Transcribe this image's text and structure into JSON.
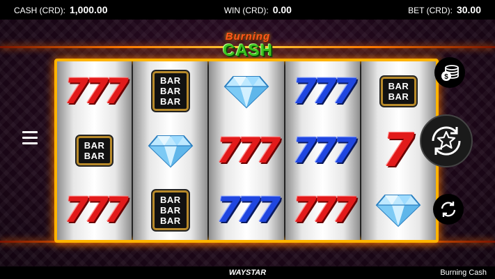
{
  "topbar": {
    "cash_label": "CASH (CRD):",
    "cash_value": "1,000.00",
    "win_label": "WIN (CRD):",
    "win_value": "0.00",
    "bet_label": "BET (CRD):",
    "bet_value": "30.00"
  },
  "logo": {
    "line1": "Burning",
    "line2": "CASH"
  },
  "reels": [
    [
      {
        "type": "seven",
        "variant": "triple-red"
      },
      {
        "type": "bar",
        "lines": [
          "BAR",
          "BAR"
        ]
      },
      {
        "type": "seven",
        "variant": "triple-red"
      }
    ],
    [
      {
        "type": "bar",
        "lines": [
          "BAR",
          "BAR",
          "BAR"
        ]
      },
      {
        "type": "diamond"
      },
      {
        "type": "bar",
        "lines": [
          "BAR",
          "BAR",
          "BAR"
        ]
      }
    ],
    [
      {
        "type": "diamond"
      },
      {
        "type": "seven",
        "variant": "triple-red"
      },
      {
        "type": "seven",
        "variant": "triple-blue"
      }
    ],
    [
      {
        "type": "seven",
        "variant": "triple-blue"
      },
      {
        "type": "seven",
        "variant": "triple-blue"
      },
      {
        "type": "seven",
        "variant": "triple-red"
      }
    ],
    [
      {
        "type": "bar",
        "lines": [
          "BAR",
          "BAR"
        ]
      },
      {
        "type": "seven",
        "variant": "single-red"
      },
      {
        "type": "diamond"
      }
    ]
  ],
  "controls": {
    "menu_icon": "hamburger-menu-icon",
    "coin_icon": "coin-stack-icon",
    "spin_icon": "spin-star-icon",
    "autoplay_icon": "autoplay-arrows-icon"
  },
  "footer": {
    "brand": "WAYSTAR",
    "game_name": "Burning Cash"
  },
  "colors": {
    "frame": "#ffb300",
    "seven_red": "#e21a1a",
    "seven_blue": "#1f46e0",
    "logo_green": "#3cc41f"
  }
}
